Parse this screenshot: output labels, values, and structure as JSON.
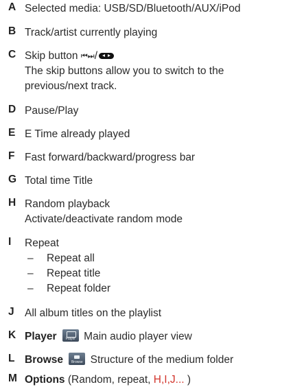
{
  "items": [
    {
      "letter": "A",
      "lines": [
        "Selected media: USB/SD/Bluetooth/AUX/iPod"
      ]
    },
    {
      "letter": "B",
      "lines": [
        "Track/artist currently playing"
      ]
    },
    {
      "letter": "C",
      "label": "Skip button",
      "glyph": "⏮⏭",
      "separator": "/",
      "lines": [
        "The skip buttons allow you to switch to the",
        "previous/next track."
      ]
    },
    {
      "letter": "D",
      "lines": [
        "Pause/Play"
      ]
    },
    {
      "letter": "E",
      "lines": [
        "E  Time already played"
      ]
    },
    {
      "letter": "F",
      "lines": [
        "Fast forward/backward/progress bar"
      ]
    },
    {
      "letter": "G",
      "lines": [
        "Total time Title"
      ]
    },
    {
      "letter": "H",
      "lines": [
        "Random  playback",
        "Activate/deactivate random mode"
      ]
    },
    {
      "letter": "I",
      "lines": [
        "Repeat"
      ],
      "subitems": [
        "Repeat all",
        "Repeat title",
        "Repeat folder"
      ],
      "dash": "–"
    },
    {
      "letter": "J",
      "lines": [
        "All album titles on the playlist"
      ]
    },
    {
      "letter": "K",
      "bold": "Player",
      "icon_label": "Player",
      "icon": "player-icon",
      "rest": "Main audio player view"
    },
    {
      "letter": "L",
      "bold": "Browse",
      "icon_label": "Browse",
      "icon": "browse-icon",
      "rest": "Structure of the medium folder"
    },
    {
      "letter": "M",
      "bold": "Options",
      "rest_pre": " (Random, repeat, ",
      "rest_red": "H,I,J...",
      "rest_post": " )",
      "red_color": "#d2342b"
    }
  ]
}
